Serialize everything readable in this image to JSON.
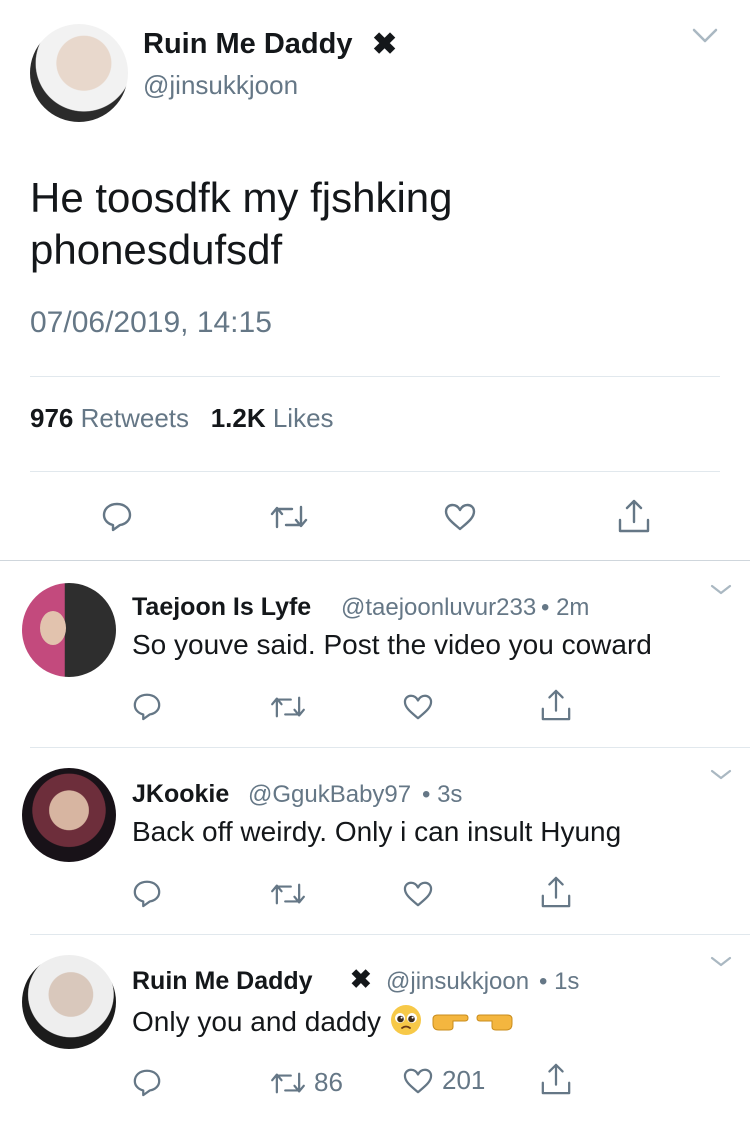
{
  "main_tweet": {
    "display_name": "Ruin Me Daddy",
    "name_mark": "✖",
    "handle": "@jinsukkjoon",
    "text": "He toosdfk my fjshking phonesdufsdf",
    "timestamp": "07/06/2019, 14:15",
    "retweets_count": "976",
    "retweets_label": "Retweets",
    "likes_count": "1.2K",
    "likes_label": "Likes",
    "icons": [
      "chevron-down-icon",
      "reply-icon",
      "retweet-icon",
      "like-icon",
      "share-icon"
    ]
  },
  "replies": [
    {
      "display_name": "Taejoon Is Lyfe",
      "handle": "@taejoonluvur233",
      "time": "• 2m",
      "text": "So youve said. Post the video you coward"
    },
    {
      "display_name": "JKookie",
      "handle": "@GgukBaby97",
      "time": "• 3s",
      "text": "Back off weirdy. Only i can insult Hyung"
    },
    {
      "display_name": "Ruin Me Daddy",
      "name_mark": "✖",
      "handle": "@jinsukkjoon",
      "time": "• 1s",
      "text": "Only you and daddy",
      "emoji_icons": [
        "pleading-face-emoji",
        "pointing-right-emoji",
        "pointing-left-emoji"
      ],
      "retweet_count": "86",
      "like_count": "201"
    }
  ],
  "colors": {
    "text_primary": "#14171a",
    "text_secondary": "#657786",
    "divider": "#e1e8ed",
    "chevron": "#aab8c2"
  }
}
